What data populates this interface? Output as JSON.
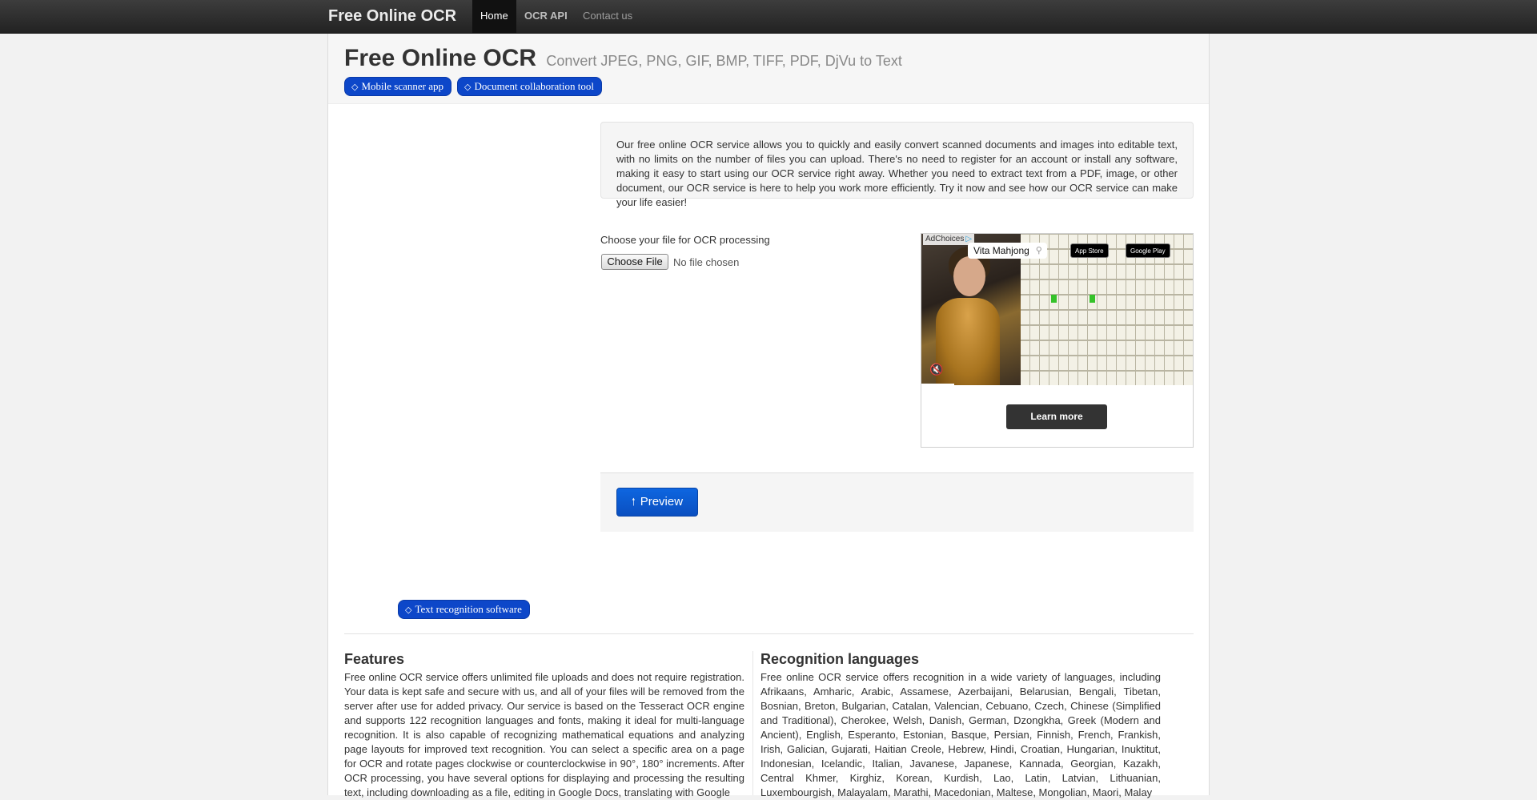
{
  "navbar": {
    "brand": "Free Online OCR",
    "items": [
      {
        "label": "Home"
      },
      {
        "label": "OCR API"
      },
      {
        "label": "Contact us"
      }
    ]
  },
  "hero": {
    "title": "Free Online OCR",
    "subtitle": "Convert JPEG, PNG, GIF, BMP, TIFF, PDF, DjVu to Text",
    "pills": [
      {
        "label": "Mobile scanner app"
      },
      {
        "label": "Document collaboration tool"
      }
    ]
  },
  "intro": {
    "text": "Our free online OCR service allows you to quickly and easily convert scanned documents and images into editable text, with no limits on the number of files you can upload. There's no need to register for an account or install any software, making it easy to start using our OCR service right away. Whether you need to extract text from a PDF, image, or other document, our OCR service is here to help you work more efficiently. Try it now and see how our OCR service can make your life easier!"
  },
  "upload": {
    "label": "Choose your file for OCR processing",
    "button_label": "Choose File",
    "status": "No file chosen"
  },
  "ad": {
    "adchoices_label": "AdChoices",
    "title": "Vita Mahjong",
    "appstore_label": "App Store",
    "googleplay_label": "Google Play",
    "cta_label": "Learn more",
    "icons": {
      "adchoices": "adchoices-triangle-icon",
      "search": "search-icon",
      "mute": "mute-icon"
    }
  },
  "actions": {
    "preview_label": "Preview",
    "preview_icon": "arrow-up-icon"
  },
  "tag_pill": {
    "label": "Text recognition software"
  },
  "sections": {
    "features": {
      "heading": "Features",
      "text": "Free online OCR service offers unlimited file uploads and does not require registration. Your data is kept safe and secure with us, and all of your files will be removed from the server after use for added privacy. Our service is based on the Tesseract OCR engine and supports 122 recognition languages and fonts, making it ideal for multi-language recognition. It is also capable of recognizing mathematical equations and analyzing page layouts for improved text recognition. You can select a specific area on a page for OCR and rotate pages clockwise or counterclockwise in 90°, 180° increments. After OCR processing, you have several options for displaying and processing the resulting text, including downloading as a file, editing in Google Docs, translating with Google"
    },
    "languages": {
      "heading": "Recognition languages",
      "text": "Free online OCR service offers recognition in a wide variety of languages, including Afrikaans, Amharic, Arabic, Assamese, Azerbaijani, Belarusian, Bengali, Tibetan, Bosnian, Breton, Bulgarian, Catalan, Valencian, Cebuano, Czech, Chinese (Simplified and Traditional), Cherokee, Welsh, Danish, German, Dzongkha, Greek (Modern and Ancient), English, Esperanto, Estonian, Basque, Persian, Finnish, French, Frankish, Irish, Galician, Gujarati, Haitian Creole, Hebrew, Hindi, Croatian, Hungarian, Inuktitut, Indonesian, Icelandic, Italian, Javanese, Japanese, Kannada, Georgian, Kazakh, Central Khmer, Kirghiz, Korean, Kurdish, Lao, Latin, Latvian, Lithuanian, Luxembourgish, Malayalam, Marathi, Macedonian, Maltese, Mongolian, Maori, Malay"
    }
  }
}
